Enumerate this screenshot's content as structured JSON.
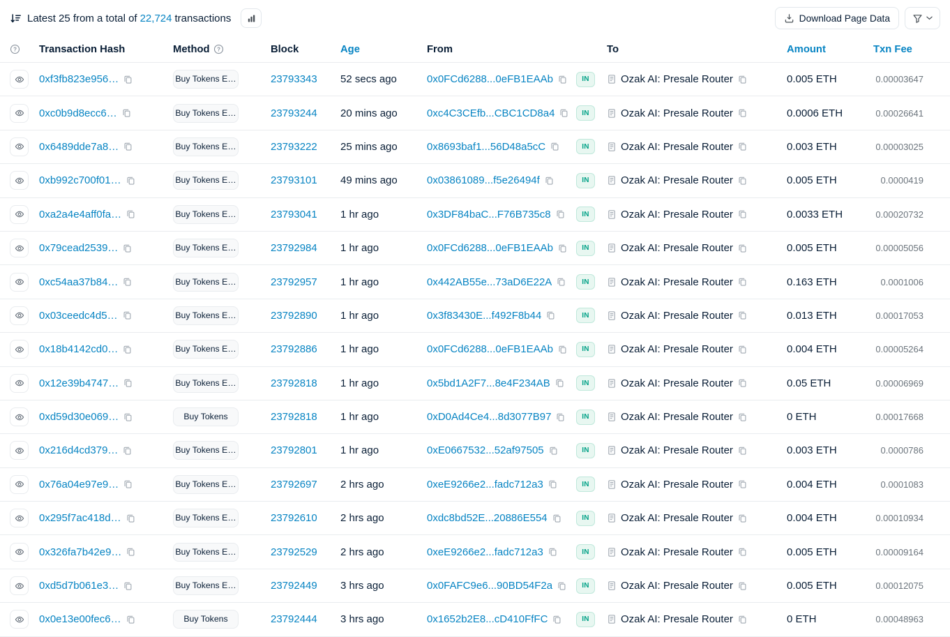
{
  "topbar": {
    "summary_prefix": "Latest 25 from a total of",
    "total_count": "22,724",
    "summary_suffix": "transactions",
    "download_button_label": "Download Page Data"
  },
  "colors": {
    "link_blue": "#0784c3",
    "text_dark": "#081d35",
    "text_gray": "#6c757d",
    "row_border": "#e9ecef",
    "badge_teal_text": "#00a186",
    "badge_teal_bg": "#e8f7f1",
    "pill_bg": "#f8f9fa"
  },
  "table": {
    "headers": {
      "hash": "Transaction Hash",
      "method": "Method",
      "block": "Block",
      "age": "Age",
      "from": "From",
      "to": "To",
      "amount": "Amount",
      "txn_fee": "Txn Fee"
    },
    "rows": [
      {
        "hash": "0xf3fb823e956…",
        "method": "Buy Tokens E…",
        "block": "23793343",
        "age": "52 secs ago",
        "from": "0x0FCd6288...0eFB1EAAb",
        "direction": "IN",
        "to": "Ozak AI: Presale Router",
        "amount": "0.005 ETH",
        "fee": "0.00003647"
      },
      {
        "hash": "0xc0b9d8ecc6…",
        "method": "Buy Tokens E…",
        "block": "23793244",
        "age": "20 mins ago",
        "from": "0xc4C3CEfb...CBC1CD8a4",
        "direction": "IN",
        "to": "Ozak AI: Presale Router",
        "amount": "0.0006 ETH",
        "fee": "0.00026641"
      },
      {
        "hash": "0x6489dde7a8…",
        "method": "Buy Tokens E…",
        "block": "23793222",
        "age": "25 mins ago",
        "from": "0x8693baf1...56D48a5cC",
        "direction": "IN",
        "to": "Ozak AI: Presale Router",
        "amount": "0.003 ETH",
        "fee": "0.00003025"
      },
      {
        "hash": "0xb992c700f01…",
        "method": "Buy Tokens E…",
        "block": "23793101",
        "age": "49 mins ago",
        "from": "0x03861089...f5e26494f",
        "direction": "IN",
        "to": "Ozak AI: Presale Router",
        "amount": "0.005 ETH",
        "fee": "0.0000419"
      },
      {
        "hash": "0xa2a4e4aff0fa…",
        "method": "Buy Tokens E…",
        "block": "23793041",
        "age": "1 hr ago",
        "from": "0x3DF84baC...F76B735c8",
        "direction": "IN",
        "to": "Ozak AI: Presale Router",
        "amount": "0.0033 ETH",
        "fee": "0.00020732"
      },
      {
        "hash": "0x79cead2539…",
        "method": "Buy Tokens E…",
        "block": "23792984",
        "age": "1 hr ago",
        "from": "0x0FCd6288...0eFB1EAAb",
        "direction": "IN",
        "to": "Ozak AI: Presale Router",
        "amount": "0.005 ETH",
        "fee": "0.00005056"
      },
      {
        "hash": "0xc54aa37b84…",
        "method": "Buy Tokens E…",
        "block": "23792957",
        "age": "1 hr ago",
        "from": "0x442AB55e...73aD6E22A",
        "direction": "IN",
        "to": "Ozak AI: Presale Router",
        "amount": "0.163 ETH",
        "fee": "0.0001006"
      },
      {
        "hash": "0x03ceedc4d5…",
        "method": "Buy Tokens E…",
        "block": "23792890",
        "age": "1 hr ago",
        "from": "0x3f83430E...f492F8b44",
        "direction": "IN",
        "to": "Ozak AI: Presale Router",
        "amount": "0.013 ETH",
        "fee": "0.00017053"
      },
      {
        "hash": "0x18b4142cd0…",
        "method": "Buy Tokens E…",
        "block": "23792886",
        "age": "1 hr ago",
        "from": "0x0FCd6288...0eFB1EAAb",
        "direction": "IN",
        "to": "Ozak AI: Presale Router",
        "amount": "0.004 ETH",
        "fee": "0.00005264"
      },
      {
        "hash": "0x12e39b4747…",
        "method": "Buy Tokens E…",
        "block": "23792818",
        "age": "1 hr ago",
        "from": "0x5bd1A2F7...8e4F234AB",
        "direction": "IN",
        "to": "Ozak AI: Presale Router",
        "amount": "0.05 ETH",
        "fee": "0.00006969"
      },
      {
        "hash": "0xd59d30e069…",
        "method": "Buy Tokens",
        "block": "23792818",
        "age": "1 hr ago",
        "from": "0xD0Ad4Ce4...8d3077B97",
        "direction": "IN",
        "to": "Ozak AI: Presale Router",
        "amount": "0 ETH",
        "fee": "0.00017668"
      },
      {
        "hash": "0x216d4cd379…",
        "method": "Buy Tokens E…",
        "block": "23792801",
        "age": "1 hr ago",
        "from": "0xE0667532...52af97505",
        "direction": "IN",
        "to": "Ozak AI: Presale Router",
        "amount": "0.003 ETH",
        "fee": "0.0000786"
      },
      {
        "hash": "0x76a04e97e9…",
        "method": "Buy Tokens E…",
        "block": "23792697",
        "age": "2 hrs ago",
        "from": "0xeE9266e2...fadc712a3",
        "direction": "IN",
        "to": "Ozak AI: Presale Router",
        "amount": "0.004 ETH",
        "fee": "0.0001083"
      },
      {
        "hash": "0x295f7ac418d…",
        "method": "Buy Tokens E…",
        "block": "23792610",
        "age": "2 hrs ago",
        "from": "0xdc8bd52E...20886E554",
        "direction": "IN",
        "to": "Ozak AI: Presale Router",
        "amount": "0.004 ETH",
        "fee": "0.00010934"
      },
      {
        "hash": "0x326fa7b42e9…",
        "method": "Buy Tokens E…",
        "block": "23792529",
        "age": "2 hrs ago",
        "from": "0xeE9266e2...fadc712a3",
        "direction": "IN",
        "to": "Ozak AI: Presale Router",
        "amount": "0.005 ETH",
        "fee": "0.00009164"
      },
      {
        "hash": "0xd5d7b061e3…",
        "method": "Buy Tokens E…",
        "block": "23792449",
        "age": "3 hrs ago",
        "from": "0x0FAFC9e6...90BD54F2a",
        "direction": "IN",
        "to": "Ozak AI: Presale Router",
        "amount": "0.005 ETH",
        "fee": "0.00012075"
      },
      {
        "hash": "0x0e13e00fec6…",
        "method": "Buy Tokens",
        "block": "23792444",
        "age": "3 hrs ago",
        "from": "0x1652b2E8...cD410FfFC",
        "direction": "IN",
        "to": "Ozak AI: Presale Router",
        "amount": "0 ETH",
        "fee": "0.00048963"
      }
    ]
  }
}
